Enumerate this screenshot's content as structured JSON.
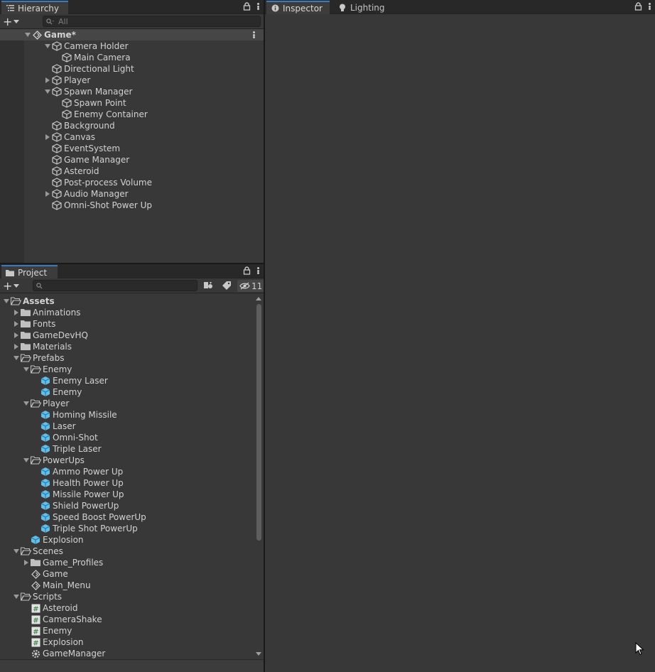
{
  "hierarchy": {
    "tab_label": "Hierarchy",
    "search_placeholder": "All",
    "scene": "Game*",
    "items": [
      {
        "label": "Camera Holder",
        "depth": 1,
        "arrow": "down"
      },
      {
        "label": "Main Camera",
        "depth": 2,
        "arrow": "none"
      },
      {
        "label": "Directional Light",
        "depth": 1,
        "arrow": "none"
      },
      {
        "label": "Player",
        "depth": 1,
        "arrow": "right"
      },
      {
        "label": "Spawn Manager",
        "depth": 1,
        "arrow": "down"
      },
      {
        "label": "Spawn Point",
        "depth": 2,
        "arrow": "none"
      },
      {
        "label": "Enemy Container",
        "depth": 2,
        "arrow": "none"
      },
      {
        "label": "Background",
        "depth": 1,
        "arrow": "none"
      },
      {
        "label": "Canvas",
        "depth": 1,
        "arrow": "right"
      },
      {
        "label": "EventSystem",
        "depth": 1,
        "arrow": "none"
      },
      {
        "label": "Game Manager",
        "depth": 1,
        "arrow": "none"
      },
      {
        "label": "Asteroid",
        "depth": 1,
        "arrow": "none"
      },
      {
        "label": "Post-process Volume",
        "depth": 1,
        "arrow": "none"
      },
      {
        "label": "Audio Manager",
        "depth": 1,
        "arrow": "right"
      },
      {
        "label": "Omni-Shot Power Up",
        "depth": 1,
        "arrow": "none"
      }
    ]
  },
  "project": {
    "tab_label": "Project",
    "hidden_count": "11",
    "items": [
      {
        "label": "Assets",
        "depth": 0,
        "arrow": "down",
        "icon": "folder-open",
        "bold": true
      },
      {
        "label": "Animations",
        "depth": 1,
        "arrow": "right",
        "icon": "folder"
      },
      {
        "label": "Fonts",
        "depth": 1,
        "arrow": "right",
        "icon": "folder"
      },
      {
        "label": "GameDevHQ",
        "depth": 1,
        "arrow": "right",
        "icon": "folder"
      },
      {
        "label": "Materials",
        "depth": 1,
        "arrow": "right",
        "icon": "folder"
      },
      {
        "label": "Prefabs",
        "depth": 1,
        "arrow": "down",
        "icon": "folder-open"
      },
      {
        "label": "Enemy",
        "depth": 2,
        "arrow": "down",
        "icon": "folder-open"
      },
      {
        "label": "Enemy Laser",
        "depth": 3,
        "arrow": "none",
        "icon": "prefab"
      },
      {
        "label": "Enemy",
        "depth": 3,
        "arrow": "none",
        "icon": "prefab"
      },
      {
        "label": "Player",
        "depth": 2,
        "arrow": "down",
        "icon": "folder-open"
      },
      {
        "label": "Homing Missile",
        "depth": 3,
        "arrow": "none",
        "icon": "prefab"
      },
      {
        "label": "Laser",
        "depth": 3,
        "arrow": "none",
        "icon": "prefab"
      },
      {
        "label": "Omni-Shot",
        "depth": 3,
        "arrow": "none",
        "icon": "prefab"
      },
      {
        "label": "Triple Laser",
        "depth": 3,
        "arrow": "none",
        "icon": "prefab"
      },
      {
        "label": "PowerUps",
        "depth": 2,
        "arrow": "down",
        "icon": "folder-open"
      },
      {
        "label": "Ammo Power Up",
        "depth": 3,
        "arrow": "none",
        "icon": "prefab"
      },
      {
        "label": "Health Power Up",
        "depth": 3,
        "arrow": "none",
        "icon": "prefab"
      },
      {
        "label": "Missile Power Up",
        "depth": 3,
        "arrow": "none",
        "icon": "prefab"
      },
      {
        "label": "Shield PowerUp",
        "depth": 3,
        "arrow": "none",
        "icon": "prefab"
      },
      {
        "label": "Speed Boost PowerUp",
        "depth": 3,
        "arrow": "none",
        "icon": "prefab"
      },
      {
        "label": "Triple Shot PowerUp",
        "depth": 3,
        "arrow": "none",
        "icon": "prefab"
      },
      {
        "label": "Explosion",
        "depth": 2,
        "arrow": "none",
        "icon": "prefab"
      },
      {
        "label": "Scenes",
        "depth": 1,
        "arrow": "down",
        "icon": "folder-open"
      },
      {
        "label": "Game_Profiles",
        "depth": 2,
        "arrow": "right",
        "icon": "folder"
      },
      {
        "label": "Game",
        "depth": 2,
        "arrow": "none",
        "icon": "scene"
      },
      {
        "label": "Main_Menu",
        "depth": 2,
        "arrow": "none",
        "icon": "scene"
      },
      {
        "label": "Scripts",
        "depth": 1,
        "arrow": "down",
        "icon": "folder-open"
      },
      {
        "label": "Asteroid",
        "depth": 2,
        "arrow": "none",
        "icon": "script"
      },
      {
        "label": "CameraShake",
        "depth": 2,
        "arrow": "none",
        "icon": "script"
      },
      {
        "label": "Enemy",
        "depth": 2,
        "arrow": "none",
        "icon": "script"
      },
      {
        "label": "Explosion",
        "depth": 2,
        "arrow": "none",
        "icon": "script"
      },
      {
        "label": "GameManager",
        "depth": 2,
        "arrow": "none",
        "icon": "gear-script"
      }
    ]
  },
  "inspector": {
    "tabs": [
      {
        "label": "Inspector",
        "icon": "info-icon"
      },
      {
        "label": "Lighting",
        "icon": "bulb-icon"
      }
    ]
  },
  "colors": {
    "prefab": "#62bde8",
    "script": "#4a8a52",
    "tab_accent": "#3a79bb"
  }
}
